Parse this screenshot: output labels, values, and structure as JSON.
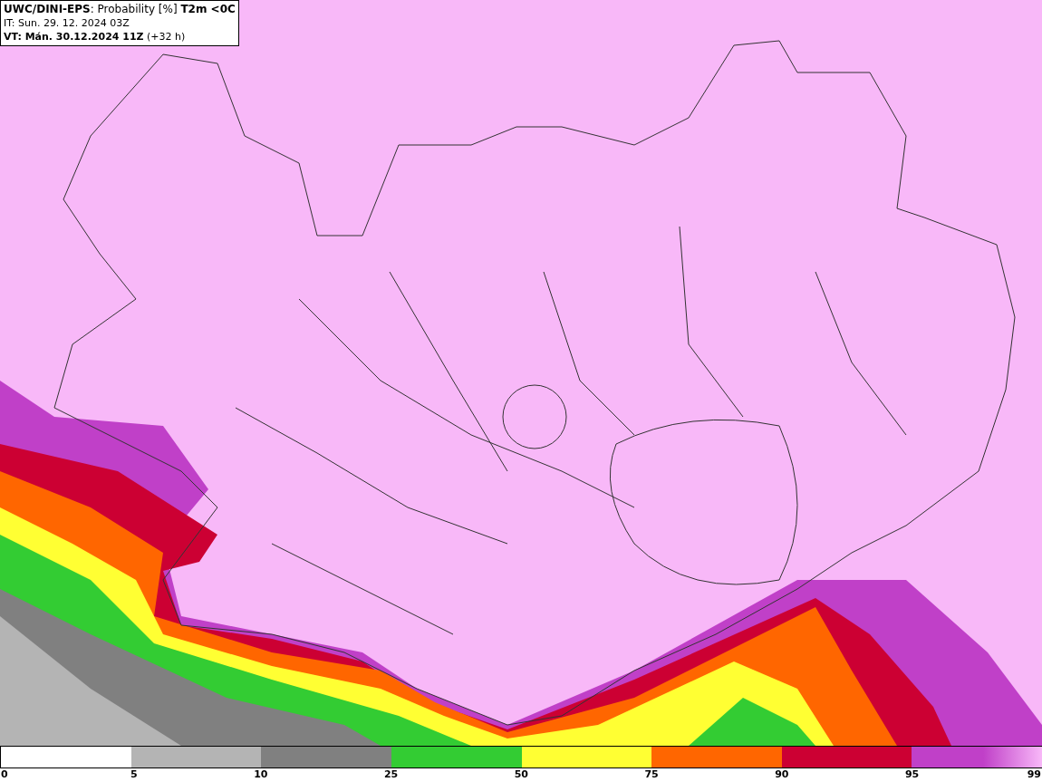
{
  "header": {
    "title": "**UWC/DINI-EPS**: Probability [%] **T2m <0C**",
    "issue_time": "IT: Sun. 29. 12. 2024 03Z",
    "valid_time": "**VT: Mán. 30.12.2024 11Z** (+32 h)"
  },
  "legend": {
    "start_label": "0",
    "segments": [
      {
        "color": "#ffffff",
        "label": "5"
      },
      {
        "color": "#b4b4b4",
        "label": "10"
      },
      {
        "color": "#808080",
        "label": "25"
      },
      {
        "color": "#33cc33",
        "label": "50"
      },
      {
        "color": "#ffff33",
        "label": "75"
      },
      {
        "color": "#ff6600",
        "label": "90"
      },
      {
        "color": "#cc0033",
        "label": "95"
      },
      {
        "color": "#c040c8",
        "label": "99"
      }
    ]
  }
}
